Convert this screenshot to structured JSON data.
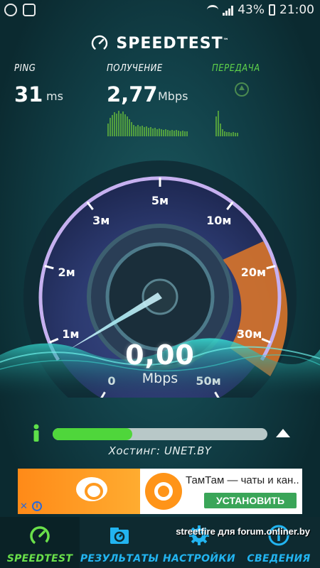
{
  "status_bar": {
    "battery": "43%",
    "time": "21:00"
  },
  "header": {
    "brand": "SPEEDTEST",
    "trademark": "™"
  },
  "stats": {
    "ping": {
      "label": "PING",
      "value": "31",
      "unit": "ms"
    },
    "download": {
      "label": "ПОЛУЧЕНИЕ",
      "value": "2,77",
      "unit": "Mbps"
    },
    "upload": {
      "label": "ПЕРЕДАЧА"
    }
  },
  "gauge": {
    "tick_labels": [
      "0",
      "1м",
      "2м",
      "3м",
      "5м",
      "10м",
      "20м",
      "30м",
      "50м"
    ],
    "needle_value": 0,
    "current_speed": "0,00",
    "speed_unit": "Mbps"
  },
  "progress": {
    "fraction": 0.37,
    "host": "Хостинг: UNET.BY"
  },
  "ad": {
    "title": "ТамТам — чаты и кан...",
    "cta": "УСТАНОВИТЬ",
    "close": "✕",
    "info": "i"
  },
  "nav": {
    "items": [
      {
        "label": "SPEEDTEST",
        "icon": "speedometer-icon",
        "active": true
      },
      {
        "label": "РЕЗУЛЬТАТЫ",
        "icon": "results-folder-icon",
        "active": false
      },
      {
        "label": "НАСТРОЙКИ",
        "icon": "gear-icon",
        "active": false
      },
      {
        "label": "СВЕДЕНИЯ",
        "icon": "info-icon",
        "active": false
      }
    ]
  },
  "watermark": "streetfire для forum.onliner.by",
  "colors": {
    "accent_green": "#4fd63b",
    "nav_blue": "#22b4f0",
    "gauge_purple": "#a07ad8",
    "gauge_orange": "#e8842a"
  }
}
